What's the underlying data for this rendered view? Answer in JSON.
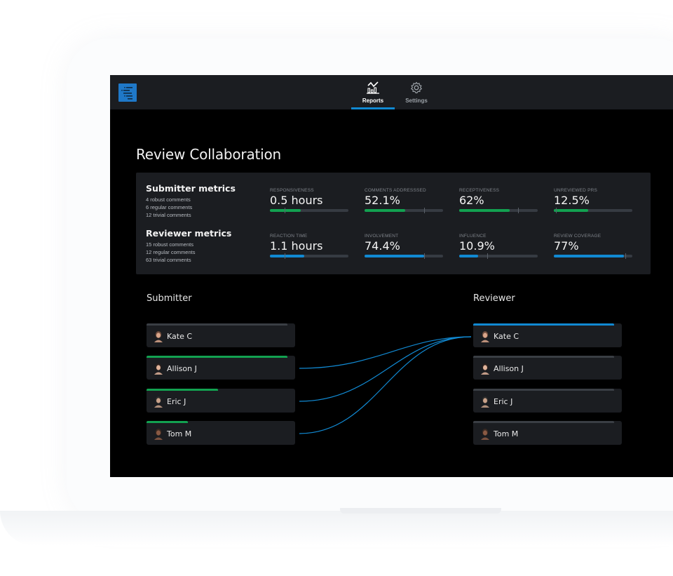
{
  "nav": {
    "logo": "logo-icon",
    "tabs": [
      {
        "label": "Reports",
        "icon": "chart-icon",
        "active": true
      },
      {
        "label": "Settings",
        "icon": "gear-icon",
        "active": false
      }
    ]
  },
  "page": {
    "title": "Review Collaboration"
  },
  "colors": {
    "green": "#12a150",
    "blue": "#1189d2",
    "track": "#363b42",
    "gray_bar": "#3a3e44"
  },
  "summary": {
    "submitter": {
      "title": "Submitter metrics",
      "lines": [
        "4 robust comments",
        "6 regular comments",
        "12 trivial comments"
      ]
    },
    "reviewer": {
      "title": "Reviewer metrics",
      "lines": [
        "15 robust comments",
        "12 regular comments",
        "63 trivial comments"
      ]
    }
  },
  "metrics": {
    "submitter": [
      {
        "label": "RESPONSIVENESS",
        "value": "0.5 hours",
        "fill": 0.39,
        "marker": 0.19
      },
      {
        "label": "COMMENTS ADDRESSSED",
        "value": "52.1%",
        "fill": 0.52,
        "marker": 0.76
      },
      {
        "label": "RECEPTIVENESS",
        "value": "62%",
        "fill": 0.64,
        "marker": 0.75
      },
      {
        "label": "UNREVIEWED PRS",
        "value": "12.5%",
        "fill": 0.44,
        "marker": 0.03
      }
    ],
    "reviewer": [
      {
        "label": "REACTION TIME",
        "value": "1.1 hours",
        "fill": 0.44,
        "marker": 0.19
      },
      {
        "label": "INVOLVEMENT",
        "value": "74.4%",
        "fill": 0.76,
        "marker": 0.76
      },
      {
        "label": "INFLUENCE",
        "value": "10.9%",
        "fill": 0.24,
        "marker": 0.36
      },
      {
        "label": "REVIEW COVERAGE",
        "value": "77%",
        "fill": 0.89,
        "marker": 0.91
      }
    ]
  },
  "collaboration": {
    "submitter_title": "Submitter",
    "reviewer_title": "Reviewer",
    "submitters": [
      {
        "name": "Kate C",
        "bar": 0.95,
        "bar_color": "gray"
      },
      {
        "name": "Allison J",
        "bar": 0.95,
        "bar_color": "green"
      },
      {
        "name": "Eric J",
        "bar": 0.48,
        "bar_color": "green"
      },
      {
        "name": "Tom M",
        "bar": 0.28,
        "bar_color": "green"
      }
    ],
    "reviewers": [
      {
        "name": "Kate C",
        "bar": 0.95,
        "bar_color": "blue"
      },
      {
        "name": "Allison J",
        "bar": 0.95,
        "bar_color": "gray"
      },
      {
        "name": "Eric J",
        "bar": 0.95,
        "bar_color": "gray"
      },
      {
        "name": "Tom M",
        "bar": 0.95,
        "bar_color": "gray"
      }
    ],
    "links": [
      {
        "from": 1,
        "to": 0
      },
      {
        "from": 2,
        "to": 0
      },
      {
        "from": 3,
        "to": 0
      }
    ]
  }
}
